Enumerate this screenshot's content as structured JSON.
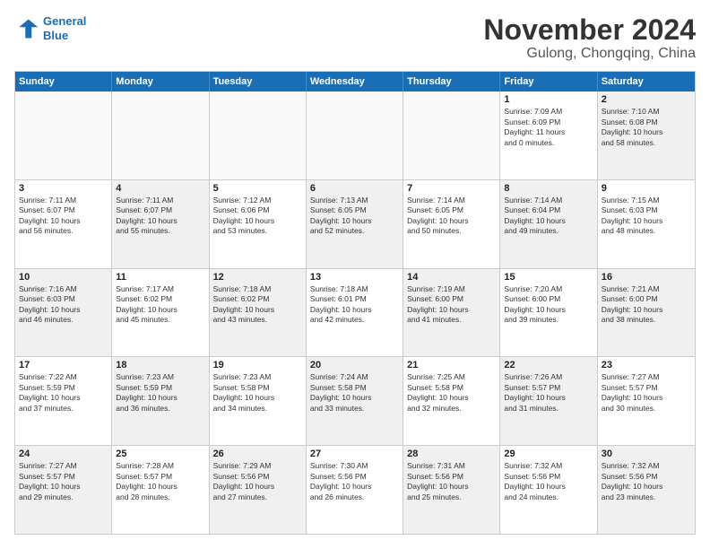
{
  "header": {
    "logo_line1": "General",
    "logo_line2": "Blue",
    "month_title": "November 2024",
    "location": "Gulong, Chongqing, China"
  },
  "weekdays": [
    "Sunday",
    "Monday",
    "Tuesday",
    "Wednesday",
    "Thursday",
    "Friday",
    "Saturday"
  ],
  "rows": [
    [
      {
        "day": "",
        "empty": true
      },
      {
        "day": "",
        "empty": true
      },
      {
        "day": "",
        "empty": true
      },
      {
        "day": "",
        "empty": true
      },
      {
        "day": "",
        "empty": true
      },
      {
        "day": "1",
        "text": "Sunrise: 7:09 AM\nSunset: 6:09 PM\nDaylight: 11 hours\nand 0 minutes.",
        "shaded": false
      },
      {
        "day": "2",
        "text": "Sunrise: 7:10 AM\nSunset: 6:08 PM\nDaylight: 10 hours\nand 58 minutes.",
        "shaded": true
      }
    ],
    [
      {
        "day": "3",
        "text": "Sunrise: 7:11 AM\nSunset: 6:07 PM\nDaylight: 10 hours\nand 56 minutes.",
        "shaded": false
      },
      {
        "day": "4",
        "text": "Sunrise: 7:11 AM\nSunset: 6:07 PM\nDaylight: 10 hours\nand 55 minutes.",
        "shaded": true
      },
      {
        "day": "5",
        "text": "Sunrise: 7:12 AM\nSunset: 6:06 PM\nDaylight: 10 hours\nand 53 minutes.",
        "shaded": false
      },
      {
        "day": "6",
        "text": "Sunrise: 7:13 AM\nSunset: 6:05 PM\nDaylight: 10 hours\nand 52 minutes.",
        "shaded": true
      },
      {
        "day": "7",
        "text": "Sunrise: 7:14 AM\nSunset: 6:05 PM\nDaylight: 10 hours\nand 50 minutes.",
        "shaded": false
      },
      {
        "day": "8",
        "text": "Sunrise: 7:14 AM\nSunset: 6:04 PM\nDaylight: 10 hours\nand 49 minutes.",
        "shaded": true
      },
      {
        "day": "9",
        "text": "Sunrise: 7:15 AM\nSunset: 6:03 PM\nDaylight: 10 hours\nand 48 minutes.",
        "shaded": false
      }
    ],
    [
      {
        "day": "10",
        "text": "Sunrise: 7:16 AM\nSunset: 6:03 PM\nDaylight: 10 hours\nand 46 minutes.",
        "shaded": true
      },
      {
        "day": "11",
        "text": "Sunrise: 7:17 AM\nSunset: 6:02 PM\nDaylight: 10 hours\nand 45 minutes.",
        "shaded": false
      },
      {
        "day": "12",
        "text": "Sunrise: 7:18 AM\nSunset: 6:02 PM\nDaylight: 10 hours\nand 43 minutes.",
        "shaded": true
      },
      {
        "day": "13",
        "text": "Sunrise: 7:18 AM\nSunset: 6:01 PM\nDaylight: 10 hours\nand 42 minutes.",
        "shaded": false
      },
      {
        "day": "14",
        "text": "Sunrise: 7:19 AM\nSunset: 6:00 PM\nDaylight: 10 hours\nand 41 minutes.",
        "shaded": true
      },
      {
        "day": "15",
        "text": "Sunrise: 7:20 AM\nSunset: 6:00 PM\nDaylight: 10 hours\nand 39 minutes.",
        "shaded": false
      },
      {
        "day": "16",
        "text": "Sunrise: 7:21 AM\nSunset: 6:00 PM\nDaylight: 10 hours\nand 38 minutes.",
        "shaded": true
      }
    ],
    [
      {
        "day": "17",
        "text": "Sunrise: 7:22 AM\nSunset: 5:59 PM\nDaylight: 10 hours\nand 37 minutes.",
        "shaded": false
      },
      {
        "day": "18",
        "text": "Sunrise: 7:23 AM\nSunset: 5:59 PM\nDaylight: 10 hours\nand 36 minutes.",
        "shaded": true
      },
      {
        "day": "19",
        "text": "Sunrise: 7:23 AM\nSunset: 5:58 PM\nDaylight: 10 hours\nand 34 minutes.",
        "shaded": false
      },
      {
        "day": "20",
        "text": "Sunrise: 7:24 AM\nSunset: 5:58 PM\nDaylight: 10 hours\nand 33 minutes.",
        "shaded": true
      },
      {
        "day": "21",
        "text": "Sunrise: 7:25 AM\nSunset: 5:58 PM\nDaylight: 10 hours\nand 32 minutes.",
        "shaded": false
      },
      {
        "day": "22",
        "text": "Sunrise: 7:26 AM\nSunset: 5:57 PM\nDaylight: 10 hours\nand 31 minutes.",
        "shaded": true
      },
      {
        "day": "23",
        "text": "Sunrise: 7:27 AM\nSunset: 5:57 PM\nDaylight: 10 hours\nand 30 minutes.",
        "shaded": false
      }
    ],
    [
      {
        "day": "24",
        "text": "Sunrise: 7:27 AM\nSunset: 5:57 PM\nDaylight: 10 hours\nand 29 minutes.",
        "shaded": true
      },
      {
        "day": "25",
        "text": "Sunrise: 7:28 AM\nSunset: 5:57 PM\nDaylight: 10 hours\nand 28 minutes.",
        "shaded": false
      },
      {
        "day": "26",
        "text": "Sunrise: 7:29 AM\nSunset: 5:56 PM\nDaylight: 10 hours\nand 27 minutes.",
        "shaded": true
      },
      {
        "day": "27",
        "text": "Sunrise: 7:30 AM\nSunset: 5:56 PM\nDaylight: 10 hours\nand 26 minutes.",
        "shaded": false
      },
      {
        "day": "28",
        "text": "Sunrise: 7:31 AM\nSunset: 5:56 PM\nDaylight: 10 hours\nand 25 minutes.",
        "shaded": true
      },
      {
        "day": "29",
        "text": "Sunrise: 7:32 AM\nSunset: 5:56 PM\nDaylight: 10 hours\nand 24 minutes.",
        "shaded": false
      },
      {
        "day": "30",
        "text": "Sunrise: 7:32 AM\nSunset: 5:56 PM\nDaylight: 10 hours\nand 23 minutes.",
        "shaded": true
      }
    ]
  ]
}
